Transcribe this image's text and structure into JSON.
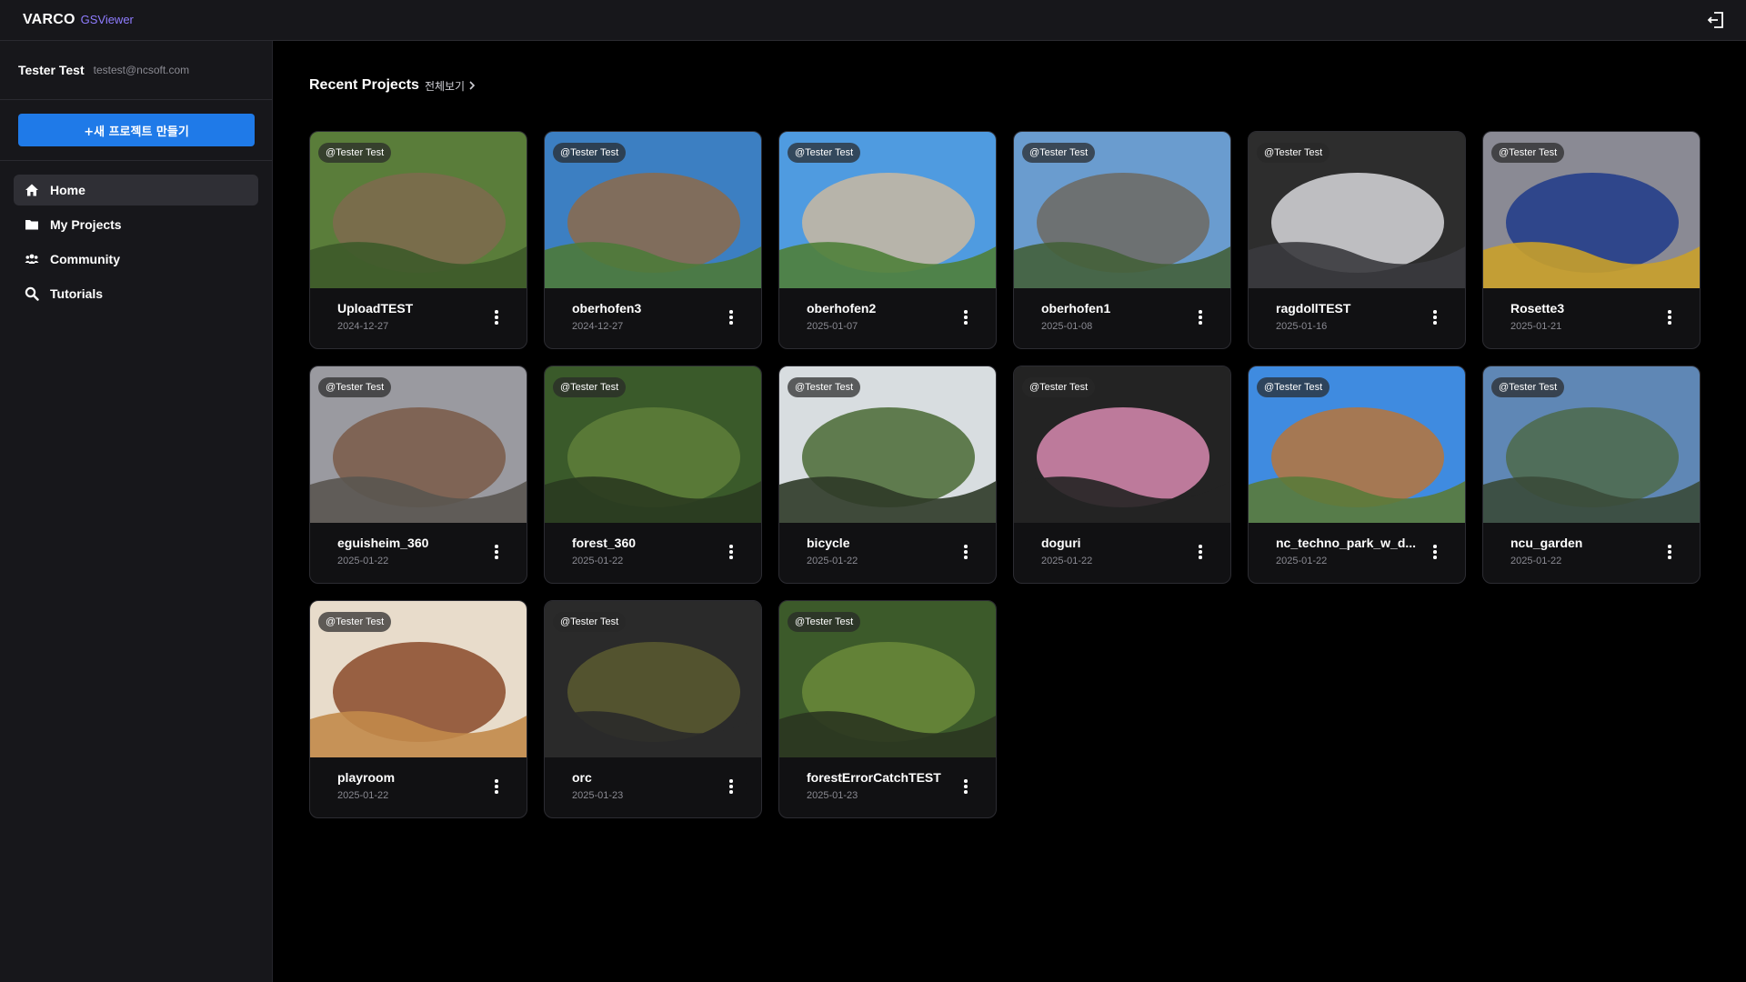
{
  "app": {
    "brand": "VARCO",
    "product": "GSViewer"
  },
  "user": {
    "name": "Tester Test",
    "email": "testest@ncsoft.com"
  },
  "sidebar": {
    "new_project_label": "+새 프로젝트 만들기",
    "items": [
      {
        "label": "Home",
        "icon": "home-icon",
        "active": true
      },
      {
        "label": "My Projects",
        "icon": "folder-icon",
        "active": false
      },
      {
        "label": "Community",
        "icon": "users-icon",
        "active": false
      },
      {
        "label": "Tutorials",
        "icon": "search-icon",
        "active": false
      }
    ]
  },
  "main": {
    "section_title": "Recent Projects",
    "view_all_label": "전체보기",
    "projects": [
      {
        "title": "UploadTEST",
        "date": "2024-12-27",
        "owner": "@Tester Test",
        "palette": [
          "#5a7d3a",
          "#7f6a4f",
          "#3d5a2a"
        ]
      },
      {
        "title": "oberhofen3",
        "date": "2024-12-27",
        "owner": "@Tester Test",
        "palette": [
          "#3c7fc2",
          "#8c6a4a",
          "#4d7a3a"
        ]
      },
      {
        "title": "oberhofen2",
        "date": "2025-01-07",
        "owner": "@Tester Test",
        "palette": [
          "#4f9be0",
          "#c9b8a0",
          "#4f7f3a"
        ]
      },
      {
        "title": "oberhofen1",
        "date": "2025-01-08",
        "owner": "@Tester Test",
        "palette": [
          "#6a9ccf",
          "#6d6a62",
          "#44603a"
        ]
      },
      {
        "title": "ragdollTEST",
        "date": "2025-01-16",
        "owner": "@Tester Test",
        "palette": [
          "#2d2d2d",
          "#d8d8dc",
          "#3a3a3e"
        ]
      },
      {
        "title": "Rosette3",
        "date": "2025-01-21",
        "owner": "@Tester Test",
        "palette": [
          "#8a8a94",
          "#1e3a8a",
          "#c9a02a"
        ]
      },
      {
        "title": "eguisheim_360",
        "date": "2025-01-22",
        "owner": "@Tester Test",
        "palette": [
          "#9a9aa0",
          "#7a5a48",
          "#5a5550"
        ]
      },
      {
        "title": "forest_360",
        "date": "2025-01-22",
        "owner": "@Tester Test",
        "palette": [
          "#3a5a2a",
          "#5f7f3a",
          "#2a3a20"
        ]
      },
      {
        "title": "bicycle",
        "date": "2025-01-22",
        "owner": "@Tester Test",
        "palette": [
          "#d8dde0",
          "#4a6a34",
          "#2f3a28"
        ]
      },
      {
        "title": "doguri",
        "date": "2025-01-22",
        "owner": "@Tester Test",
        "palette": [
          "#232323",
          "#d88ab0",
          "#232323"
        ]
      },
      {
        "title": "nc_techno_park_w_d...",
        "date": "2025-01-22",
        "owner": "@Tester Test",
        "palette": [
          "#3f8be0",
          "#b7743a",
          "#5a7a3a"
        ]
      },
      {
        "title": "ncu_garden",
        "date": "2025-01-22",
        "owner": "@Tester Test",
        "palette": [
          "#5f87b5",
          "#4e6a4a",
          "#3a4a38"
        ]
      },
      {
        "title": "playroom",
        "date": "2025-01-22",
        "owner": "@Tester Test",
        "palette": [
          "#e8dccb",
          "#8a4a2a",
          "#c28a4a"
        ]
      },
      {
        "title": "orc",
        "date": "2025-01-23",
        "owner": "@Tester Test",
        "palette": [
          "#2a2a2a",
          "#5a5a30",
          "#2a2a2a"
        ]
      },
      {
        "title": "forestErrorCatchTEST",
        "date": "2025-01-23",
        "owner": "@Tester Test",
        "palette": [
          "#3c5a2a",
          "#6a8a3a",
          "#2a3520"
        ]
      }
    ]
  }
}
